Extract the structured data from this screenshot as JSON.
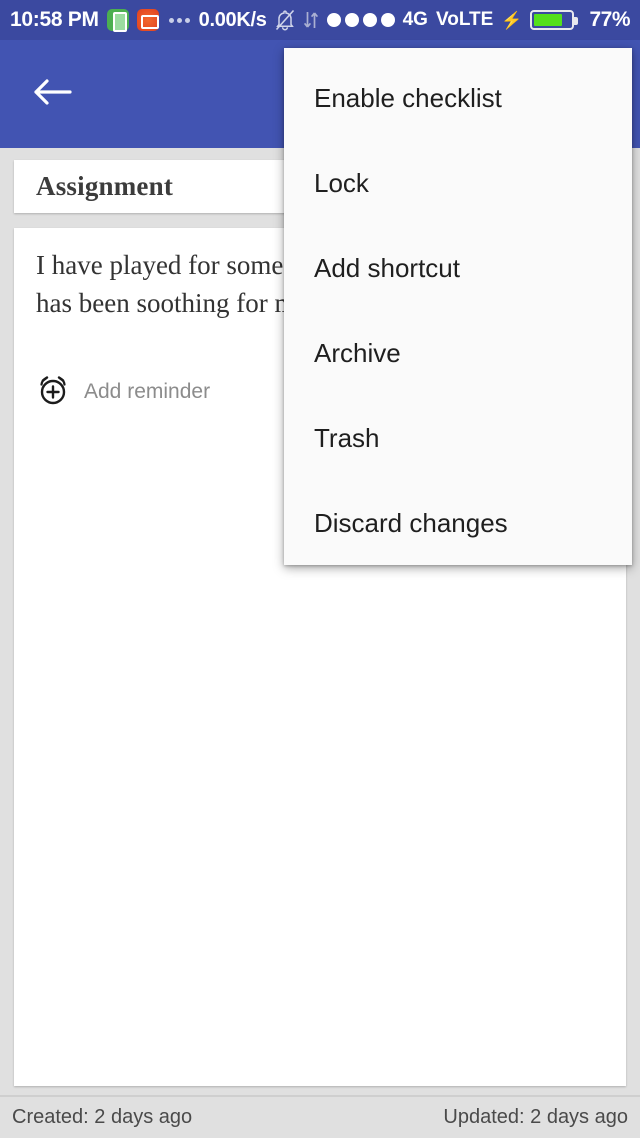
{
  "status_bar": {
    "clock": "10:58 PM",
    "icons": [
      "battery-saver-app-icon",
      "screen-recorder-app-icon",
      "more-notifications-icon",
      "silent-mode-icon",
      "data-transfer-icon"
    ],
    "net_speed": "0.00K/s",
    "signal_dots": 4,
    "network_type": "4G",
    "volte": "VoLTE",
    "charging": true,
    "battery_percent": "77%",
    "battery_level": 77,
    "background_color": "#3b49a0",
    "battery_color": "#54e01c"
  },
  "app_bar": {
    "back_icon": "back-arrow-icon",
    "actions": [
      "attach-icon"
    ],
    "background_color": "#4254b2"
  },
  "note": {
    "title": "Assignment",
    "body": "I have played for some time and it\nhas been soothing for me",
    "reminder_label": "Add reminder",
    "reminder_icon": "alarm-add-icon"
  },
  "footer": {
    "created": "Created: 2 days ago",
    "updated": "Updated: 2 days ago"
  },
  "popup_menu": {
    "items": [
      {
        "label": "Enable checklist"
      },
      {
        "label": "Lock"
      },
      {
        "label": "Add shortcut"
      },
      {
        "label": "Archive"
      },
      {
        "label": "Trash"
      },
      {
        "label": "Discard changes"
      }
    ]
  }
}
